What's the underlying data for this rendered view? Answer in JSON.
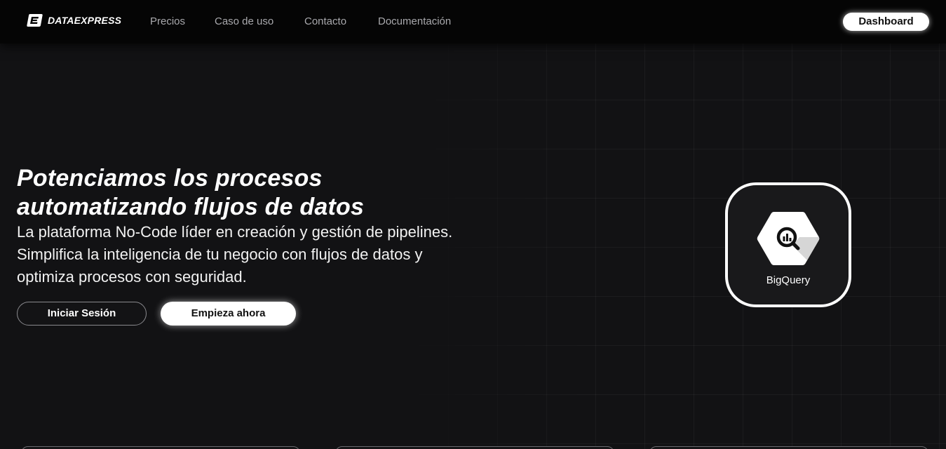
{
  "brand": {
    "name": "DATAEXPRESS",
    "icon": "dataexpress-logo-icon"
  },
  "nav": {
    "links": [
      "Precios",
      "Caso de uso",
      "Contacto",
      "Documentación"
    ],
    "dashboard_label": "Dashboard"
  },
  "hero": {
    "title_line1": "Potenciamos los procesos",
    "title_line2": "automatizando flujos de datos",
    "subtitle": "La plataforma No-Code líder en creación y gestión de pipelines. Simplifica la inteligencia de tu negocio con flujos de datos y optimiza procesos con seguridad.",
    "login_label": "Iniciar Sesión",
    "start_label": "Empieza ahora"
  },
  "integration_card": {
    "label": "BigQuery",
    "icon": "bigquery-icon"
  },
  "colors": {
    "background": "#121214",
    "navbar": "#050505",
    "accent_white": "#ffffff",
    "nav_text": "#a9a9ad"
  }
}
